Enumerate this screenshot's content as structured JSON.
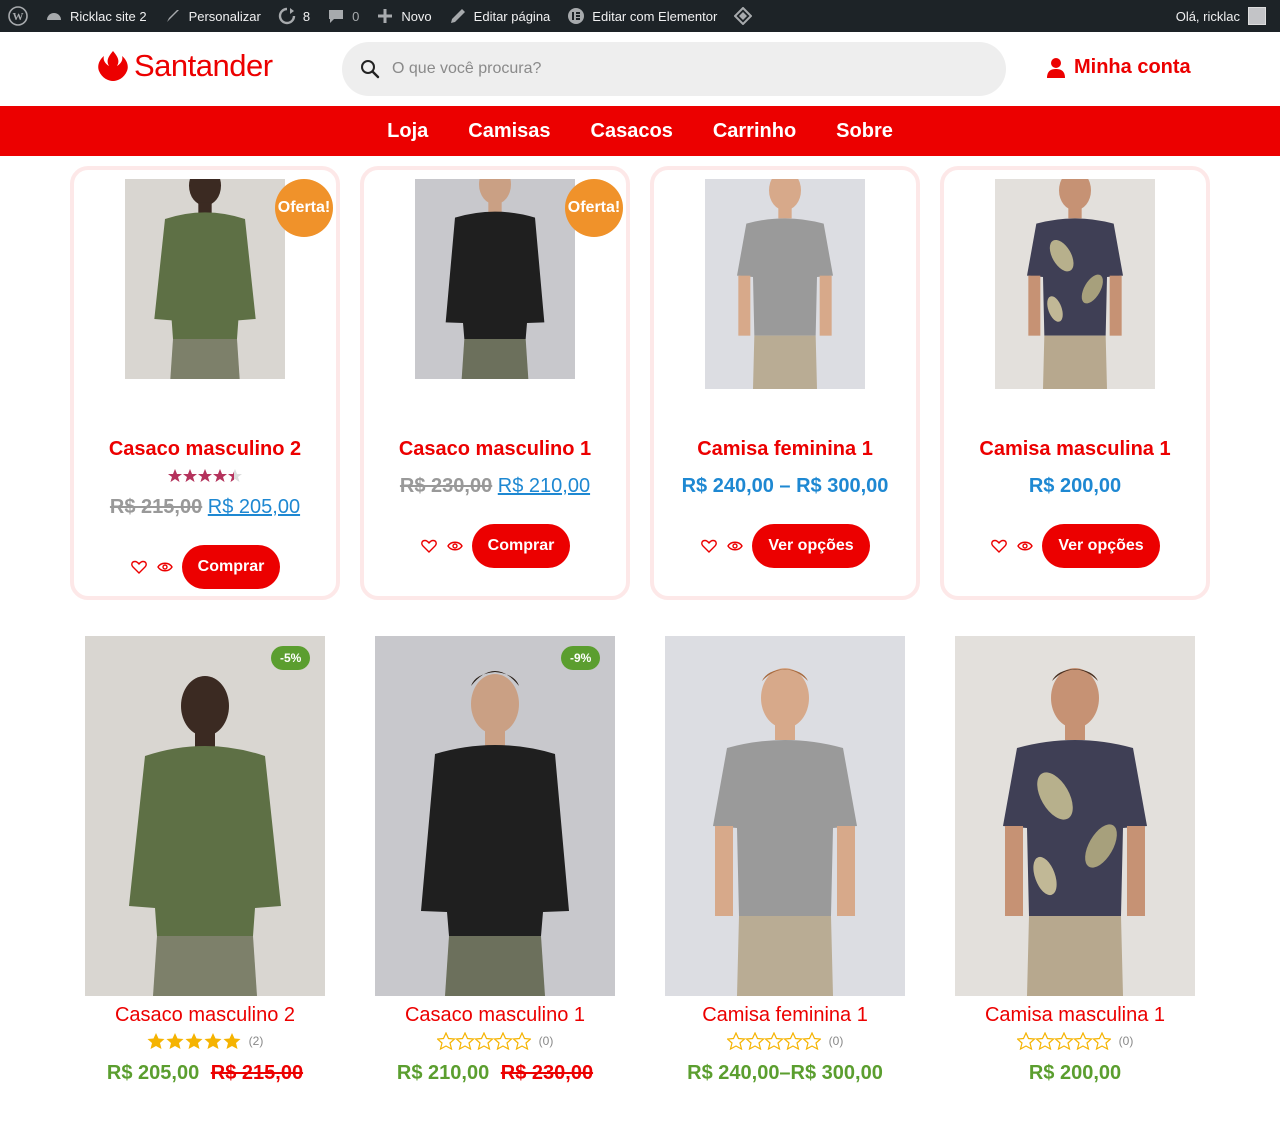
{
  "adminbar": {
    "site": "Ricklac site 2",
    "customize": "Personalizar",
    "updates": "8",
    "comments": "0",
    "new": "Novo",
    "edit_page": "Editar página",
    "edit_elementor": "Editar com Elementor",
    "greeting": "Olá, ricklac"
  },
  "header": {
    "logo": "Santander",
    "search_placeholder": "O que você procura?",
    "account": "Minha conta"
  },
  "nav": [
    "Loja",
    "Camisas",
    "Casacos",
    "Carrinho",
    "Sobre"
  ],
  "colors": {
    "brand": "#ec0000",
    "offer_badge": "#f0922a",
    "discount_badge": "#5b9e2f",
    "price_link": "#1e88d2"
  },
  "featured": [
    {
      "title": "Casaco masculino 2",
      "badge": "Oferta!",
      "rating": 4.5,
      "old_price": "R$ 215,00",
      "price": "R$ 205,00",
      "button": "Comprar",
      "image": "green-sweater"
    },
    {
      "title": "Casaco masculino 1",
      "badge": "Oferta!",
      "old_price": "R$ 230,00",
      "price": "R$ 210,00",
      "button": "Comprar",
      "image": "black-sweater"
    },
    {
      "title": "Camisa feminina 1",
      "price_range": "R$ 240,00 – R$ 300,00",
      "button": "Ver opções",
      "image": "grey-shirt"
    },
    {
      "title": "Camisa masculina 1",
      "price_range": "R$ 200,00",
      "button": "Ver opções",
      "image": "floral-shirt"
    }
  ],
  "products": [
    {
      "title": "Casaco masculino 2",
      "badge": "-5%",
      "rating": 5,
      "count": "(2)",
      "price": "R$ 205,00",
      "old_price": "R$ 215,00"
    },
    {
      "title": "Casaco masculino 1",
      "badge": "-9%",
      "rating": 0,
      "count": "(0)",
      "price": "R$ 210,00",
      "old_price": "R$ 230,00"
    },
    {
      "title": "Camisa feminina 1",
      "rating": 0,
      "count": "(0)",
      "price": "R$ 240,00–R$ 300,00"
    },
    {
      "title": "Camisa masculina 1",
      "rating": 0,
      "count": "(0)",
      "price": "R$ 200,00"
    }
  ]
}
